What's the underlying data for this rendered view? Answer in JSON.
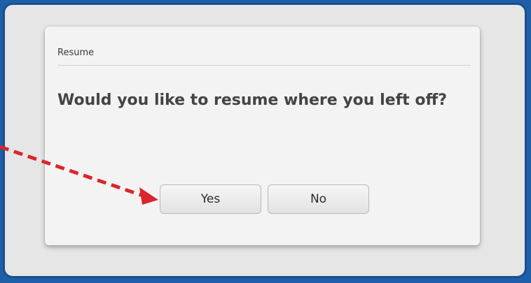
{
  "dialog": {
    "title": "Resume",
    "message": "Would you like to resume where you left off?",
    "yes_label": "Yes",
    "no_label": "No"
  },
  "annotation": {
    "arrow_color": "#d9262b",
    "points_to": "yes-button"
  },
  "colors": {
    "frame_border": "#1a4f91",
    "background": "#e6e6e6",
    "dialog_bg": "#f3f3f3"
  }
}
